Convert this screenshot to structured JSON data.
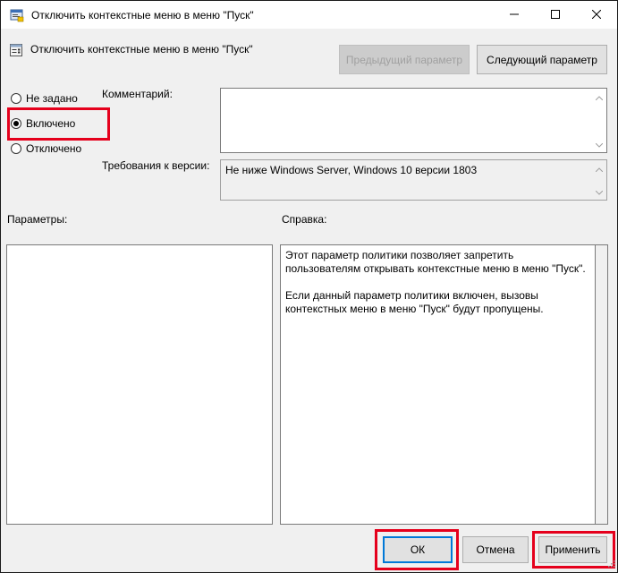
{
  "window": {
    "title": "Отключить контекстные меню в меню \"Пуск\""
  },
  "header": {
    "title": "Отключить контекстные меню в меню \"Пуск\""
  },
  "nav": {
    "prev_label": "Предыдущий параметр",
    "next_label": "Следующий параметр"
  },
  "state": {
    "options": [
      {
        "label": "Не задано",
        "selected": false
      },
      {
        "label": "Включено",
        "selected": true
      },
      {
        "label": "Отключено",
        "selected": false
      }
    ]
  },
  "comment": {
    "label": "Комментарий:",
    "value": ""
  },
  "version": {
    "label": "Требования к версии:",
    "value": "Не ниже Windows Server, Windows 10 версии 1803"
  },
  "params": {
    "label": "Параметры:"
  },
  "help": {
    "label": "Справка:",
    "paragraphs": [
      "Этот параметр политики позволяет запретить пользователям открывать контекстные меню в меню \"Пуск\".",
      "Если данный параметр политики включен, вызовы контекстных меню в меню \"Пуск\" будут пропущены."
    ]
  },
  "footer": {
    "ok_label": "ОК",
    "cancel_label": "Отмена",
    "apply_label": "Применить"
  },
  "colors": {
    "highlight": "#e5001c",
    "accent": "#0078d7"
  },
  "icons": {
    "app": "policy-app-icon",
    "header": "policy-setting-icon",
    "minimize": "minimize-icon",
    "maximize": "maximize-icon",
    "close": "close-icon"
  }
}
